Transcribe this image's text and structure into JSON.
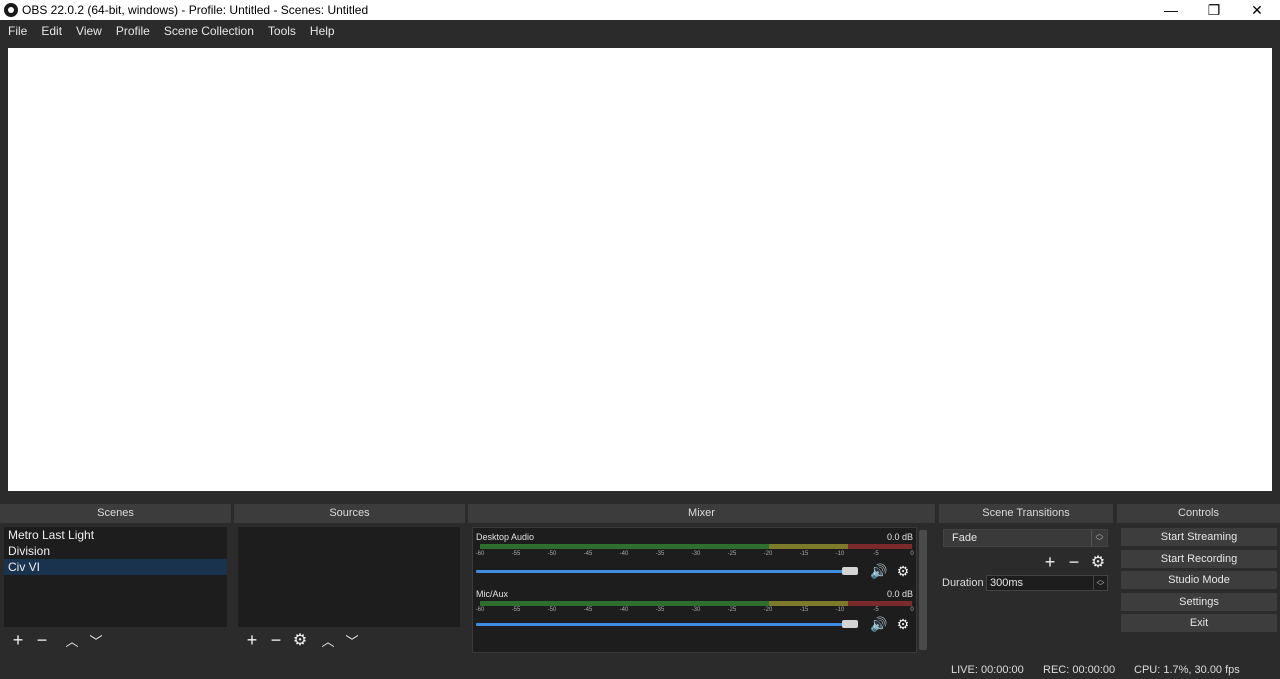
{
  "window": {
    "title": "OBS 22.0.2 (64-bit, windows) - Profile: Untitled - Scenes: Untitled",
    "minimize_glyph": "—",
    "maximize_glyph": "❐",
    "close_glyph": "✕"
  },
  "menu": [
    "File",
    "Edit",
    "View",
    "Profile",
    "Scene Collection",
    "Tools",
    "Help"
  ],
  "docks": {
    "scenes": "Scenes",
    "sources": "Sources",
    "mixer": "Mixer",
    "transitions": "Scene Transitions",
    "controls": "Controls"
  },
  "scenes": {
    "items": [
      "Metro Last Light",
      "Division",
      "Civ VI"
    ],
    "selected_index": 2
  },
  "mixer": {
    "ticks": [
      "-60",
      "-55",
      "-50",
      "-45",
      "-40",
      "-35",
      "-30",
      "-25",
      "-20",
      "-15",
      "-10",
      "-5",
      "0"
    ],
    "channels": [
      {
        "name": "Desktop Audio",
        "db": "0.0 dB",
        "volume_fraction": 1.0
      },
      {
        "name": "Mic/Aux",
        "db": "0.0 dB",
        "volume_fraction": 1.0
      }
    ]
  },
  "transitions": {
    "selected": "Fade",
    "duration_label": "Duration",
    "duration_value": "300ms"
  },
  "controls": {
    "buttons": [
      "Start Streaming",
      "Start Recording",
      "Studio Mode",
      "Settings",
      "Exit"
    ]
  },
  "status": {
    "live": "LIVE: 00:00:00",
    "rec": "REC: 00:00:00",
    "cpu": "CPU: 1.7%, 30.00 fps"
  },
  "colors": {
    "background": "#2b2b2b",
    "selection": "#19324e",
    "volume_slider": "#3d8ee0"
  }
}
